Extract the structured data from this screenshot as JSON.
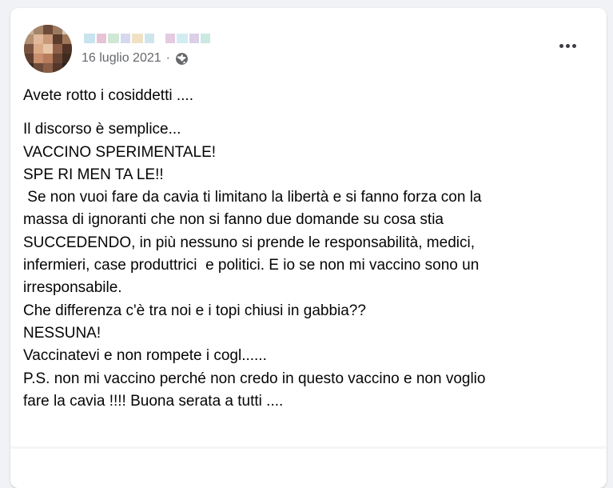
{
  "post": {
    "date": "16 luglio 2021",
    "separator": "·",
    "audience_icon": "globe-icon",
    "menu_icon": "more-options-icon",
    "first_line": "Avete rotto i cosiddetti ....",
    "lines": [
      "Il discorso è semplice...",
      "VACCINO SPERIMENTALE!",
      "SPE RI MEN TA LE!!",
      " Se non vuoi fare da cavia ti limitano la libertà e si fanno forza con la",
      "massa di ignoranti che non si fanno due domande su cosa stia",
      "SUCCEDENDO, in più nessuno si prende le responsabilità, medici,",
      "infermieri, case produttrici  e politici. E io se non mi vaccino sono un",
      "irresponsabile.",
      "Che differenza c'è tra noi e i topi chiusi in gabbia??",
      "NESSUNA!",
      "Vaccinatevi e non rompete i cogl......",
      "P.S. non mi vaccino perché non credo in questo vaccino e non voglio",
      "fare la cavia !!!! Buona serata a tutti ...."
    ]
  },
  "colors": {
    "background": "#f0f2f5",
    "card": "#ffffff",
    "text": "#050505",
    "meta": "#65676b"
  }
}
